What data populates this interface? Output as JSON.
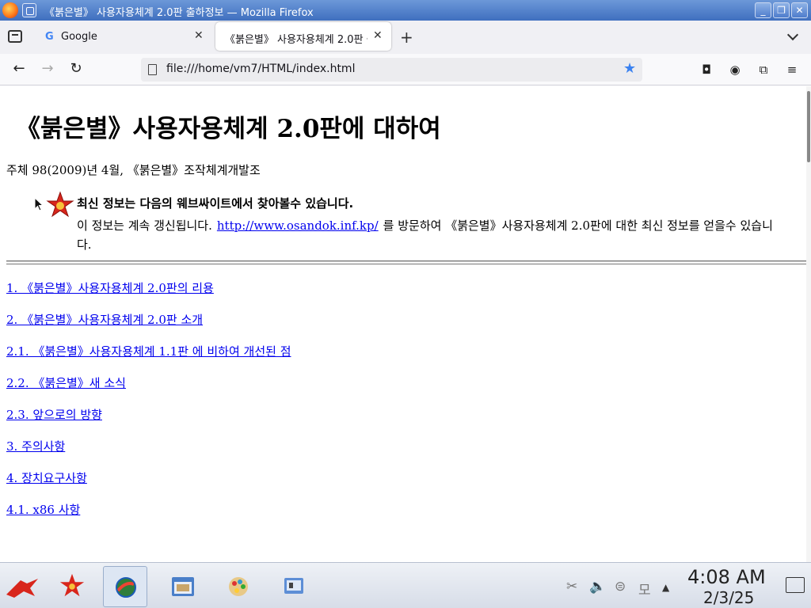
{
  "window": {
    "title": "《붉은별》 사용자용체계 2.0판 출하정보 — Mozilla Firefox",
    "minimize": "_",
    "maximize": "❐",
    "close": "✕"
  },
  "tabs": [
    {
      "label": "Google",
      "close": "✕"
    },
    {
      "label": "《붉은별》 사용자용체계 2.0판 출",
      "close": "✕"
    }
  ],
  "new_tab": "+",
  "navbar": {
    "back": "←",
    "forward": "→",
    "reload": "↻",
    "url": "file:///home/vm7/HTML/index.html"
  },
  "page": {
    "heading": "《붉은별》사용자용체계 2.0판에 대하여",
    "byline": "주체 98(2009)년 4월, 《붉은별》조작체계개발조",
    "notice": {
      "title": "최신 정보는 다음의 웨브싸이트에서 찾아볼수 있습니다.",
      "text_before": "이 정보는 계속 갱신됩니다.",
      "link": "http://www.osandok.inf.kp/",
      "text_after": "를 방문하여 《붉은별》사용자용체계 2.0판에 대한 최신 정보를 얻을수 있습니다."
    },
    "toc": [
      "1. 《붉은별》사용자용체계 2.0판의 리용",
      "2. 《붉은별》사용자용체계 2.0판 소개",
      "2.1. 《붉은별》사용자용체계 1.1판 에 비하여 개선된 점",
      "2.2. 《붉은별》새 소식",
      "2.3. 앞으로의 방향",
      "3. 주의사항",
      "4. 장치요구사항",
      "4.1. x86 사항"
    ]
  },
  "taskbar": {
    "tray": [
      "✂",
      "🔈",
      "⊜",
      "모",
      "▲"
    ],
    "clock_time": "4:08 AM",
    "clock_date": "2/3/25"
  },
  "colors": {
    "link": "#0000ee",
    "titlebar": "#4a78c6",
    "bookmark_star": "#3b82f0"
  }
}
